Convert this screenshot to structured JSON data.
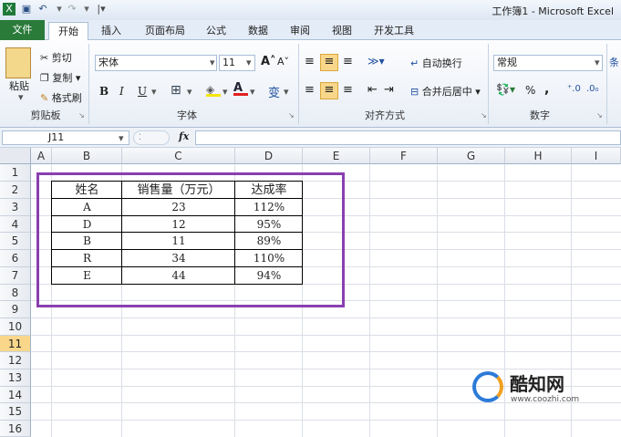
{
  "title": "工作簿1 - Microsoft Excel",
  "tabs": [
    "文件",
    "开始",
    "插入",
    "页面布局",
    "公式",
    "数据",
    "审阅",
    "视图",
    "开发工具"
  ],
  "clipboard": {
    "paste": "粘贴",
    "cut": "剪切",
    "copy": "复制",
    "format_painter": "格式刷",
    "group": "剪贴板"
  },
  "font": {
    "name": "宋体",
    "size": "11",
    "bold": "B",
    "italic": "I",
    "underline": "U",
    "group": "字体"
  },
  "alignment": {
    "wrap": "自动换行",
    "merge": "合并后居中",
    "group": "对齐方式"
  },
  "number": {
    "format": "常规",
    "percent": "%",
    "comma": ",",
    "group": "数字"
  },
  "name_box": "J11",
  "fx": "fx",
  "columns": [
    "A",
    "B",
    "C",
    "D",
    "E",
    "F",
    "G",
    "H",
    "I"
  ],
  "rows": [
    "1",
    "2",
    "3",
    "4",
    "5",
    "6",
    "7",
    "8",
    "9",
    "10",
    "11",
    "12",
    "13",
    "14",
    "15",
    "16"
  ],
  "table": {
    "headers": [
      "姓名",
      "销售量（万元）",
      "达成率"
    ],
    "rows": [
      [
        "A",
        "23",
        "112%"
      ],
      [
        "D",
        "12",
        "95%"
      ],
      [
        "B",
        "11",
        "89%"
      ],
      [
        "R",
        "34",
        "110%"
      ],
      [
        "E",
        "44",
        "94%"
      ]
    ]
  },
  "watermark": {
    "name": "酷知网",
    "url": "www.coozhi.com"
  },
  "colors": {
    "file_tab": "#2a7a3a",
    "selection_box": "#8a3fb0",
    "selected_row": "#f9d78a"
  }
}
